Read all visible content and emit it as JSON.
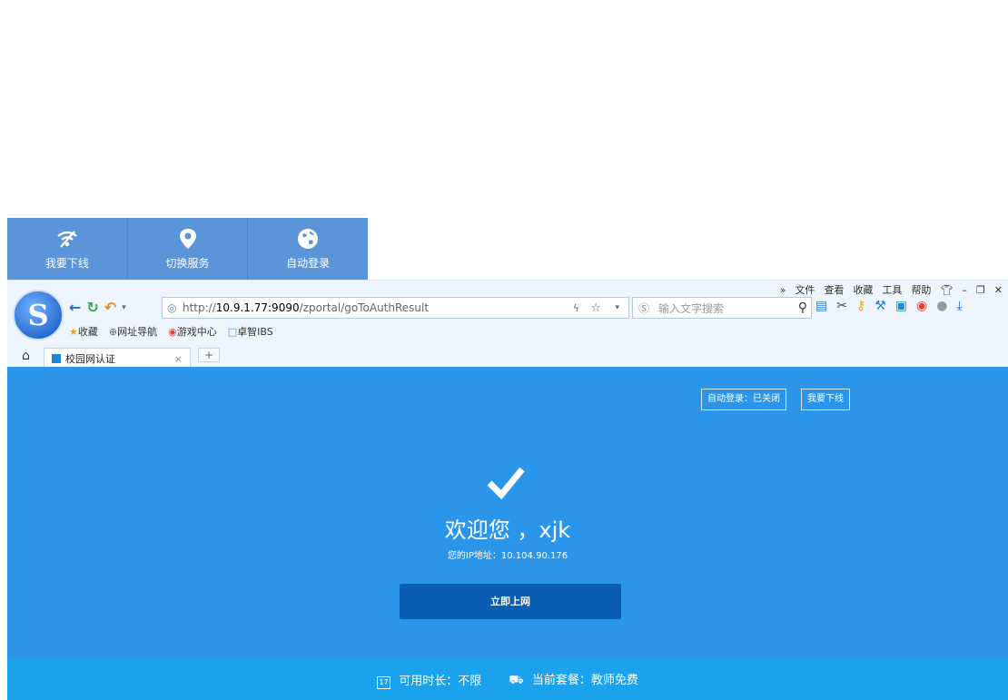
{
  "widget": {
    "buttons": [
      {
        "label": "我要下线",
        "icon": "wifi-off-icon"
      },
      {
        "label": "切换服务",
        "icon": "location-pin-icon"
      },
      {
        "label": "自动登录",
        "icon": "globe-icon"
      }
    ]
  },
  "browser": {
    "menu": [
      "»",
      "文件",
      "查看",
      "收藏",
      "工具",
      "帮助"
    ],
    "address": {
      "prefix": "http://",
      "host": "10.9.1.77:9090",
      "path": "/zportal/goToAuthResult"
    },
    "search_placeholder": "输入文字搜索",
    "favorites": [
      "收藏",
      "网址导航",
      "游戏中心",
      "卓智IBS"
    ],
    "tab_title": "校园网认证"
  },
  "page": {
    "auto_login_button": "自动登录：已关闭",
    "logout_button": "我要下线",
    "welcome_prefix": "欢迎您",
    "username": "，xjk",
    "ip_label": "您的IP地址：",
    "ip_value": "10.104.90.176",
    "main_button": "立即上网",
    "footer": {
      "duration_label": "可用时长：",
      "duration_value": "不限",
      "package_label": "当前套餐：",
      "package_value": "教师免费"
    }
  },
  "colors": {
    "page_bg": "#2b95ea",
    "footer_bg": "#1aa3ec",
    "primary_button": "#0a5eb4",
    "widget_bar": "#5b95d9"
  }
}
